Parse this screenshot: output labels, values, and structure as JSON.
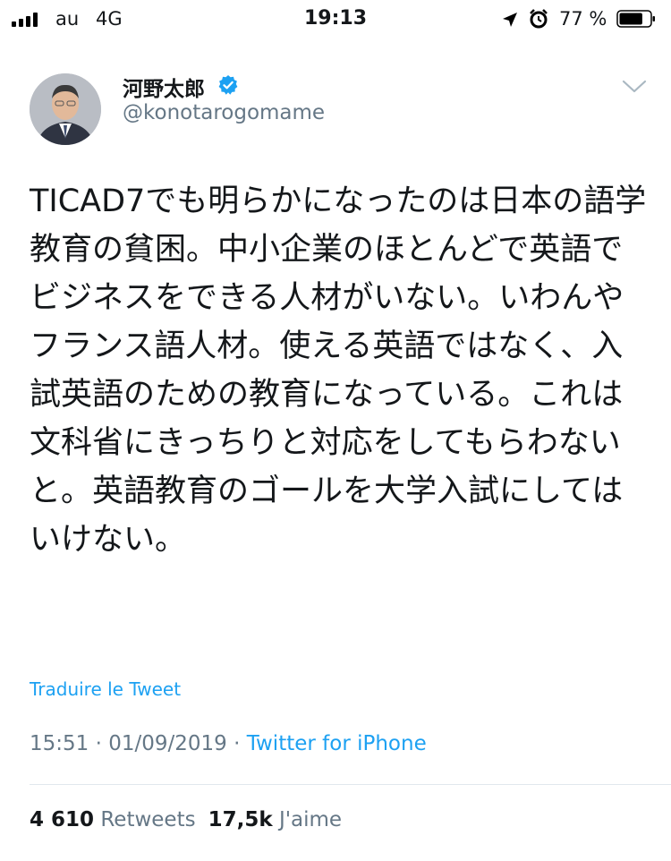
{
  "status_bar": {
    "carrier": "au",
    "network": "4G",
    "time": "19:13",
    "battery_percent": "77 %",
    "battery_level": 0.77,
    "icons": [
      "signal-icon",
      "location-icon",
      "alarm-icon",
      "battery-icon"
    ]
  },
  "tweet": {
    "display_name": "河野太郎",
    "handle": "@konotarogomame",
    "verified": true,
    "text": "TICAD7でも明らかになったのは日本の語学教育の貧困。中小企業のほとんどで英語でビジネスをできる人材がいない。いわんやフランス語人材。使える英語ではなく、入試英語のための教育になっている。これは文科省にきっちりと対応をしてもらわないと。英語教育のゴールを大学入試にしてはいけない。",
    "translate_label": "Traduire le Tweet",
    "time": "15:51",
    "date": "01/09/2019",
    "separator": "·",
    "source": "Twitter for iPhone",
    "retweets_count": "4 610",
    "retweets_label": "Retweets",
    "likes_count": "17,5k",
    "likes_label": "J'aime"
  },
  "colors": {
    "accent": "#1da1f2",
    "secondary_text": "#657786",
    "primary_text": "#14171a",
    "divider": "#e1e8ed"
  }
}
